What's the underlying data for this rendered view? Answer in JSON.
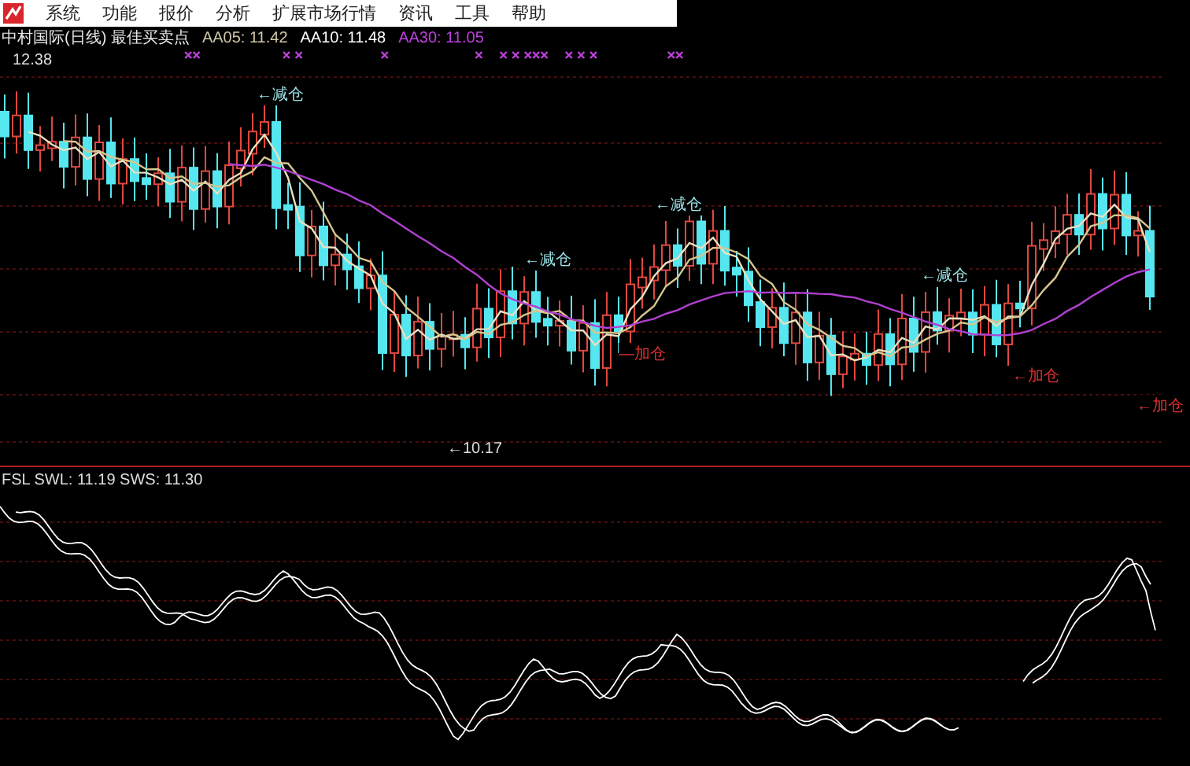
{
  "menu": [
    "系统",
    "功能",
    "报价",
    "分析",
    "扩展市场行情",
    "资讯",
    "工具",
    "帮助"
  ],
  "header": {
    "title": "中村国际(日线) 最佳买卖点",
    "averages": [
      {
        "label": "AA05: 11.42",
        "kind": "ma5"
      },
      {
        "label": "AA10: 11.48",
        "kind": "ma10"
      },
      {
        "label": "AA30: 11.05",
        "kind": "ma30"
      }
    ]
  },
  "price_panel": {
    "high_label": "12.38",
    "low_label": "←10.17",
    "signals": [
      {
        "label": "←减仓",
        "kind": "reduce"
      },
      {
        "label": "←减仓",
        "kind": "reduce"
      },
      {
        "label": "←减仓",
        "kind": "reduce"
      },
      {
        "label": "←减仓",
        "kind": "reduce"
      },
      {
        "label": "—加仓",
        "kind": "add"
      },
      {
        "label": "←加仓",
        "kind": "add"
      },
      {
        "label": "←加仓",
        "kind": "add"
      }
    ]
  },
  "indicator_panel": {
    "title": "FSL SWL: 11.19 SWS: 11.30"
  }
}
